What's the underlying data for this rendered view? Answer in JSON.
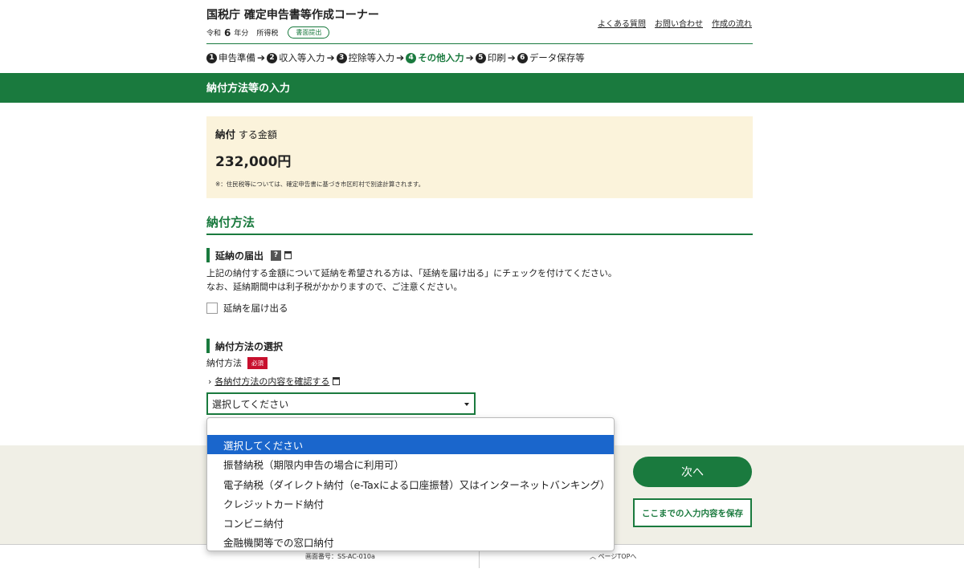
{
  "header": {
    "site_title": "国税庁 確定申告書等作成コーナー",
    "era": "令和",
    "year": "6",
    "year_suffix": "年分",
    "tax_type": "所得税",
    "submit_badge": "書面提出",
    "links": [
      "よくある質問",
      "お問い合わせ",
      "作成の流れ"
    ]
  },
  "steps": [
    {
      "num": "1",
      "label": "申告準備"
    },
    {
      "num": "2",
      "label": "収入等入力"
    },
    {
      "num": "3",
      "label": "控除等入力"
    },
    {
      "num": "4",
      "label": "その他入力",
      "active": true
    },
    {
      "num": "5",
      "label": "印刷"
    },
    {
      "num": "6",
      "label": "データ保存等"
    }
  ],
  "page_title": "納付方法等の入力",
  "amount": {
    "label_bold": "納付",
    "label_rest": "する金額",
    "value": "232,000円",
    "note": "※：住民税等については、確定申告書に基づき市区町村で別途計算されます。"
  },
  "section": {
    "title": "納付方法",
    "deferral": {
      "heading": "延納の届出",
      "help_icon": "?",
      "line1": "上記の納付する金額について延納を希望される方は、「延納を届け出る」にチェックを付けてください。",
      "line2": "なお、延納期間中は利子税がかかりますので、ご注意ください。",
      "checkbox_label": "延納を届け出る"
    },
    "method": {
      "heading": "納付方法の選択",
      "label": "納付方法",
      "required_badge": "必須",
      "confirm_link": "各納付方法の内容を確認する",
      "selected": "選択してください",
      "options": [
        "選択してください",
        "振替納税（期限内申告の場合に利用可）",
        "電子納税（ダイレクト納付（e-Taxによる口座振替）又はインターネットバンキング）",
        "クレジットカード納付",
        "コンビニ納付",
        "金融機関等での窓口納付"
      ]
    }
  },
  "buttons": {
    "next": "次へ",
    "save": "ここまでの入力内容を保存"
  },
  "footer": {
    "screen_no": "画面番号：SS-AC-010a",
    "page_top": "ページTOPへ"
  },
  "colors": {
    "brand_green": "#1a7a3e",
    "amount_bg": "#fbf3db",
    "required_red": "#c8102e",
    "selection_blue": "#1a66cc"
  }
}
